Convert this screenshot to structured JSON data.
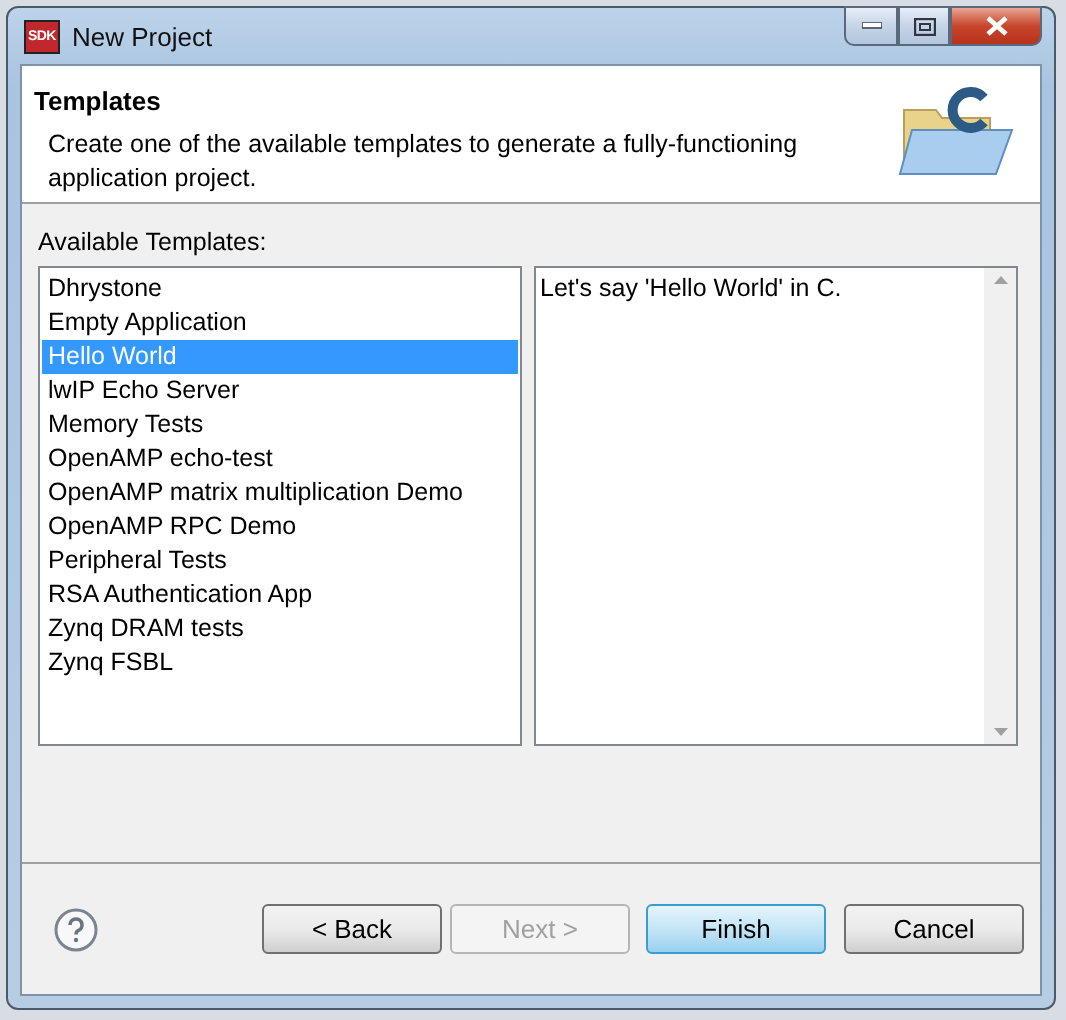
{
  "window": {
    "title": "New Project",
    "logo_text": "SDK"
  },
  "header": {
    "title": "Templates",
    "description": "Create one of the available templates to generate a fully-functioning application project."
  },
  "templates": {
    "label": "Available Templates:",
    "items": [
      {
        "label": "Dhrystone",
        "selected": false
      },
      {
        "label": "Empty Application",
        "selected": false
      },
      {
        "label": "Hello World",
        "selected": true
      },
      {
        "label": "lwIP Echo Server",
        "selected": false
      },
      {
        "label": "Memory Tests",
        "selected": false
      },
      {
        "label": "OpenAMP echo-test",
        "selected": false
      },
      {
        "label": "OpenAMP matrix multiplication Demo",
        "selected": false
      },
      {
        "label": "OpenAMP RPC Demo",
        "selected": false
      },
      {
        "label": "Peripheral Tests",
        "selected": false
      },
      {
        "label": "RSA Authentication App",
        "selected": false
      },
      {
        "label": "Zynq DRAM tests",
        "selected": false
      },
      {
        "label": "Zynq FSBL",
        "selected": false
      }
    ]
  },
  "description_panel": {
    "text": "Let's say 'Hello World' in C."
  },
  "buttons": [
    {
      "label": "< Back",
      "disabled": false,
      "default": false
    },
    {
      "label": "Next >",
      "disabled": true,
      "default": false
    },
    {
      "label": "Finish",
      "disabled": false,
      "default": true
    },
    {
      "label": "Cancel",
      "disabled": false,
      "default": false
    }
  ]
}
